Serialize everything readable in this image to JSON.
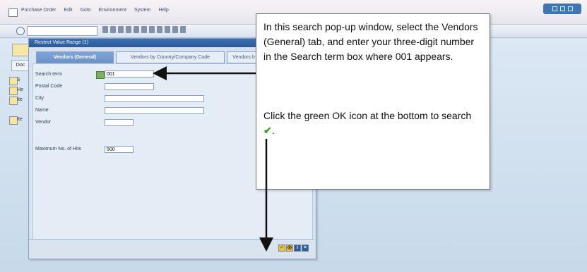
{
  "menu": {
    "items": [
      "Purchase Order",
      "Edit",
      "Goto",
      "Environment",
      "System",
      "Help"
    ]
  },
  "toolbar": {
    "command_value": "",
    "ok_icon": "ok-icon"
  },
  "background": {
    "top_tab_label": "",
    "doc_button_label": "Doc",
    "left_items": [
      "S",
      "He",
      "Ite",
      "Ite"
    ]
  },
  "popup": {
    "title": "Restrict Value Range (1)",
    "tabs": [
      "Vendors (General)",
      "Vendors by Country/Company Code",
      "Vendors b"
    ],
    "fields": {
      "search_term": {
        "label": "Search term",
        "value": "001"
      },
      "postal_code": {
        "label": "Postal Code",
        "value": ""
      },
      "city": {
        "label": "City",
        "value": ""
      },
      "name": {
        "label": "Name",
        "value": ""
      },
      "vendor": {
        "label": "Vendor",
        "value": ""
      },
      "max_hits": {
        "label": "Maximum No. of Hits",
        "value": "500"
      }
    },
    "buttons": [
      "ok-icon",
      "search-icon",
      "info-icon",
      "close-icon"
    ]
  },
  "annotation": {
    "paragraph_1": "In this search pop-up window, select the Vendors (General) tab, and enter your three-digit number in the Search term box where 001 appears.",
    "paragraph_2": "Click the green OK icon at the bottom to search",
    "check_glyph": "✔",
    "period": "."
  },
  "colors": {
    "accent": "#3d6eb0",
    "ok_green": "#33a02c",
    "highlight": "#f0c238"
  }
}
